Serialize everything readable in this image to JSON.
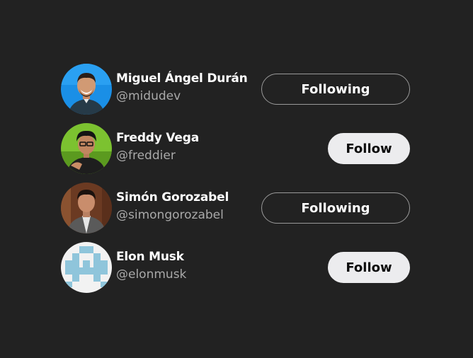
{
  "users": [
    {
      "name": "Miguel Ángel Durán",
      "handle": "@midudev",
      "button_label": "Following",
      "is_following": true,
      "avatar_icon": "person-photo",
      "avatar_bg": "#1a8fe6"
    },
    {
      "name": "Freddy Vega",
      "handle": "@freddier",
      "button_label": "Follow",
      "is_following": false,
      "avatar_icon": "person-photo",
      "avatar_bg": "#7cc230"
    },
    {
      "name": "Simón Gorozabel",
      "handle": "@simongorozabel",
      "button_label": "Following",
      "is_following": true,
      "avatar_icon": "person-photo",
      "avatar_bg": "#6b3a22"
    },
    {
      "name": "Elon Musk",
      "handle": "@elonmusk",
      "button_label": "Follow",
      "is_following": false,
      "avatar_icon": "pixel-invader-icon",
      "avatar_bg": "#f2f2f2"
    }
  ],
  "colors": {
    "background": "#222222",
    "name_text": "#ffffff",
    "handle_text": "#a9a9a9",
    "following_border": "#9a9a9a",
    "follow_bg": "#ececee"
  }
}
